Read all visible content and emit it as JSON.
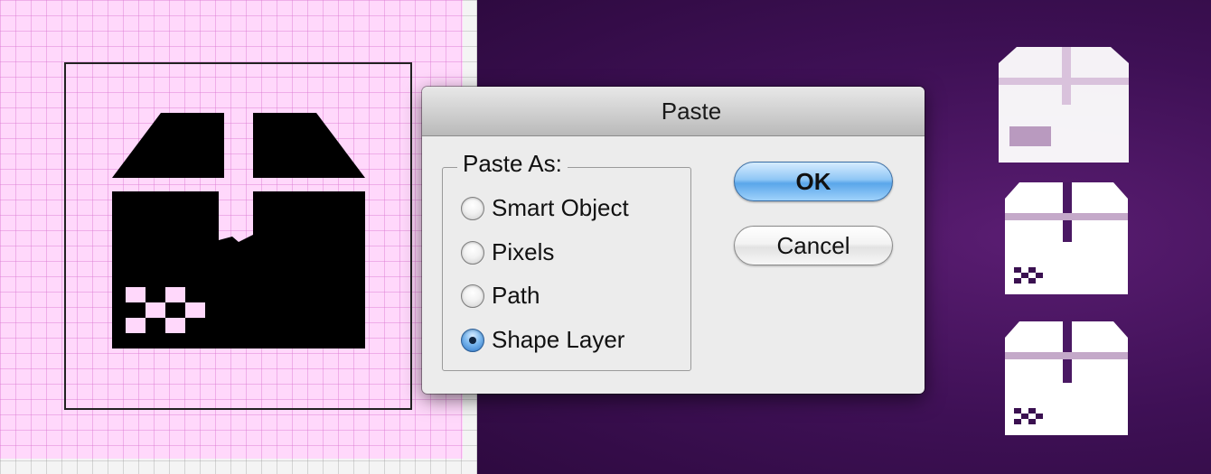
{
  "dialog": {
    "title": "Paste",
    "group_label": "Paste As:",
    "options": [
      {
        "label": "Smart Object",
        "checked": false
      },
      {
        "label": "Pixels",
        "checked": false
      },
      {
        "label": "Path",
        "checked": false
      },
      {
        "label": "Shape Layer",
        "checked": true
      }
    ],
    "ok_label": "OK",
    "cancel_label": "Cancel"
  },
  "colors": {
    "pink_canvas": "#ffd8fb",
    "purple_canvas": "#3e1055",
    "box_icon": "#000000",
    "preview_icon": "#ffffff",
    "default_button": "#5aa6ea"
  },
  "icons": {
    "main_artwork": "package-box-icon",
    "previews": [
      "package-box-icon",
      "package-box-icon",
      "package-box-icon"
    ]
  }
}
